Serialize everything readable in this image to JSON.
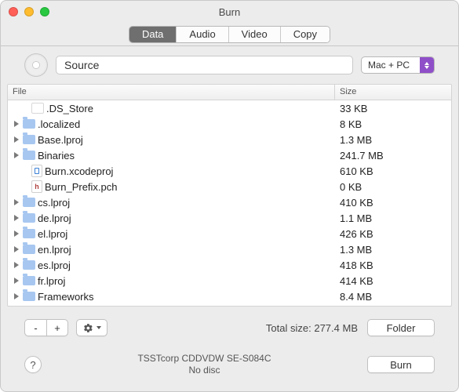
{
  "window": {
    "title": "Burn"
  },
  "tabs": {
    "data": "Data",
    "audio": "Audio",
    "video": "Video",
    "copy": "Copy",
    "active": "data"
  },
  "toolbar": {
    "source_value": "Source",
    "compat_label": "Mac + PC"
  },
  "columns": {
    "file": "File",
    "size": "Size"
  },
  "files": [
    {
      "name": ".DS_Store",
      "size": "33 KB",
      "icon": "blank",
      "expandable": false
    },
    {
      "name": ".localized",
      "size": "8 KB",
      "icon": "folder",
      "expandable": true
    },
    {
      "name": "Base.lproj",
      "size": "1.3 MB",
      "icon": "folder",
      "expandable": true
    },
    {
      "name": "Binaries",
      "size": "241.7 MB",
      "icon": "folder",
      "expandable": true
    },
    {
      "name": "Burn.xcodeproj",
      "size": "610 KB",
      "icon": "proj",
      "expandable": false
    },
    {
      "name": "Burn_Prefix.pch",
      "size": "0 KB",
      "icon": "h",
      "expandable": false
    },
    {
      "name": "cs.lproj",
      "size": "410 KB",
      "icon": "folder",
      "expandable": true
    },
    {
      "name": "de.lproj",
      "size": "1.1 MB",
      "icon": "folder",
      "expandable": true
    },
    {
      "name": "el.lproj",
      "size": "426 KB",
      "icon": "folder",
      "expandable": true
    },
    {
      "name": "en.lproj",
      "size": "1.3 MB",
      "icon": "folder",
      "expandable": true
    },
    {
      "name": "es.lproj",
      "size": "418 KB",
      "icon": "folder",
      "expandable": true
    },
    {
      "name": "fr.lproj",
      "size": "414 KB",
      "icon": "folder",
      "expandable": true
    },
    {
      "name": "Frameworks",
      "size": "8.4 MB",
      "icon": "folder",
      "expandable": true
    }
  ],
  "footer": {
    "remove_label": "-",
    "add_label": "+",
    "total_prefix": "Total size: ",
    "total_size": "277.4 MB",
    "folder_label": "Folder"
  },
  "device": {
    "name": "TSSTcorp CDDVDW SE-S084C",
    "status": "No disc"
  },
  "actions": {
    "burn_label": "Burn"
  },
  "help": {
    "label": "?"
  }
}
